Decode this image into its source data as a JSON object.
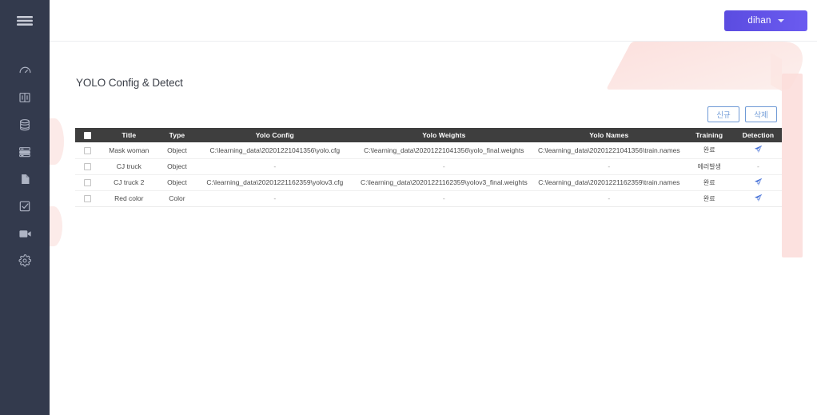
{
  "app": {
    "user_label": "dihan",
    "menu_icon": "hamburger-icon"
  },
  "sidebar": {
    "items": [
      {
        "icon": "dashboard-icon",
        "name": "sidebar-item-dashboard"
      },
      {
        "icon": "book-icon",
        "name": "sidebar-item-book"
      },
      {
        "icon": "database-icon",
        "name": "sidebar-item-database"
      },
      {
        "icon": "server-icon",
        "name": "sidebar-item-server"
      },
      {
        "icon": "document-icon",
        "name": "sidebar-item-document"
      },
      {
        "icon": "checkbox-icon",
        "name": "sidebar-item-tasks"
      },
      {
        "icon": "video-camera-icon",
        "name": "sidebar-item-video"
      },
      {
        "icon": "gear-icon",
        "name": "sidebar-item-settings"
      }
    ]
  },
  "page": {
    "title": "YOLO Config & Detect"
  },
  "toolbar": {
    "new_label": "신규",
    "delete_label": "삭제"
  },
  "table": {
    "headers": {
      "select": "",
      "title": "Title",
      "type": "Type",
      "yolo_config": "Yolo Config",
      "yolo_weights": "Yolo Weights",
      "yolo_names": "Yolo Names",
      "training": "Training",
      "detection": "Detection"
    },
    "rows": [
      {
        "checked": false,
        "title": "Mask woman",
        "type": "Object",
        "yolo_config": "C:\\learning_data\\20201221041356\\yolo.cfg",
        "yolo_weights": "C:\\learning_data\\20201221041356\\yolo_final.weights",
        "yolo_names": "C:\\learning_data\\20201221041356\\train.names",
        "training": "완료",
        "detection": "send-icon"
      },
      {
        "checked": false,
        "title": "CJ truck",
        "type": "Object",
        "yolo_config": "-",
        "yolo_weights": "-",
        "yolo_names": "-",
        "training": "에러발생",
        "detection": "-"
      },
      {
        "checked": false,
        "title": "CJ truck 2",
        "type": "Object",
        "yolo_config": "C:\\learning_data\\20201221162359\\yolov3.cfg",
        "yolo_weights": "C:\\learning_data\\20201221162359\\yolov3_final.weights",
        "yolo_names": "C:\\learning_data\\20201221162359\\train.names",
        "training": "완료",
        "detection": "send-icon"
      },
      {
        "checked": false,
        "title": "Red color",
        "type": "Color",
        "yolo_config": "-",
        "yolo_weights": "-",
        "yolo_names": "-",
        "training": "완료",
        "detection": "send-icon"
      }
    ]
  },
  "colors": {
    "sidebar_bg": "#333a4d",
    "accent_purple": "#5b4ce0",
    "table_header_bg": "#3e3e3e",
    "button_outline": "#6f9ad6",
    "detect_icon": "#4a74d8",
    "decor_pink": "#fbdcd9"
  }
}
